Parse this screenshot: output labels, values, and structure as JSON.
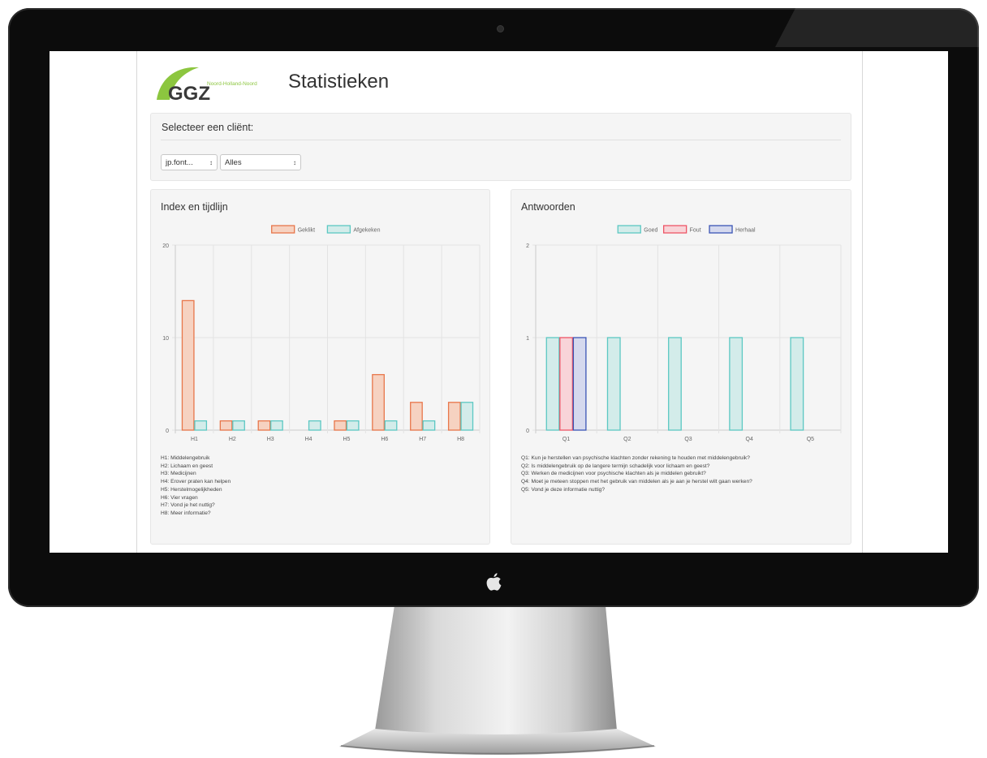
{
  "page": {
    "title": "Statistieken",
    "logo": {
      "text": "GGZ",
      "subtitle": "Noord-Holland-Noord"
    }
  },
  "client_panel": {
    "title": "Selecteer een cliënt:",
    "client_select": {
      "value": "jp.font..."
    },
    "filter_select": {
      "value": "Alles"
    }
  },
  "left_panel": {
    "title": "Index en tijdlijn",
    "notes": [
      "H1: Middelengebruik",
      "H2: Lichaam en geest",
      "H3: Medicijnen",
      "H4: Erover praten kan helpen",
      "H5: Herstelmogelijkheden",
      "H6: Vier vragen",
      "H7: Vond je het nuttig?",
      "H8: Meer informatie?"
    ]
  },
  "right_panel": {
    "title": "Antwoorden",
    "notes": [
      "Q1: Kun je herstellen van psychische klachten zonder rekening te houden met middelengebruik?",
      "Q2: Is middelengebruik op de langere termijn schadelijk voor lichaam en geest?",
      "Q3: Werken de medicijnen voor psychische klachten als je middelen gebruikt?",
      "Q4: Moet je meteen stoppen met het gebruik van middelen als je aan je herstel wilt gaan werken?",
      "Q5: Vond je deze informatie nuttig?"
    ]
  },
  "colors": {
    "orange_fill": "#f6d2c1",
    "orange_stroke": "#e8764a",
    "teal_fill": "#d3ecea",
    "teal_stroke": "#5cc8c3",
    "red_fill": "#f8d4d8",
    "red_stroke": "#ee5566",
    "blue_fill": "#d5d9ee",
    "blue_stroke": "#3b55b5",
    "logo_green": "#8cc63f"
  },
  "chart_data": [
    {
      "type": "bar",
      "categories": [
        "H1",
        "H2",
        "H3",
        "H4",
        "H5",
        "H6",
        "H7",
        "H8"
      ],
      "series": [
        {
          "name": "Geklikt",
          "values": [
            14,
            1,
            1,
            0,
            1,
            6,
            3,
            3
          ]
        },
        {
          "name": "Afgekeken",
          "values": [
            1,
            1,
            1,
            1,
            1,
            1,
            1,
            3
          ]
        }
      ],
      "ylim": [
        0,
        20
      ],
      "yticks": [
        0,
        10,
        20
      ],
      "grid": true,
      "legend": "top-center"
    },
    {
      "type": "bar",
      "categories": [
        "Q1",
        "Q2",
        "Q3",
        "Q4",
        "Q5"
      ],
      "series": [
        {
          "name": "Goed",
          "values": [
            1,
            1,
            1,
            1,
            1
          ]
        },
        {
          "name": "Fout",
          "values": [
            1,
            0,
            0,
            0,
            0
          ]
        },
        {
          "name": "Herhaal",
          "values": [
            1,
            0,
            0,
            0,
            0
          ]
        }
      ],
      "ylim": [
        0,
        2
      ],
      "yticks": [
        0,
        1,
        2
      ],
      "grid": true,
      "legend": "top-center"
    }
  ]
}
